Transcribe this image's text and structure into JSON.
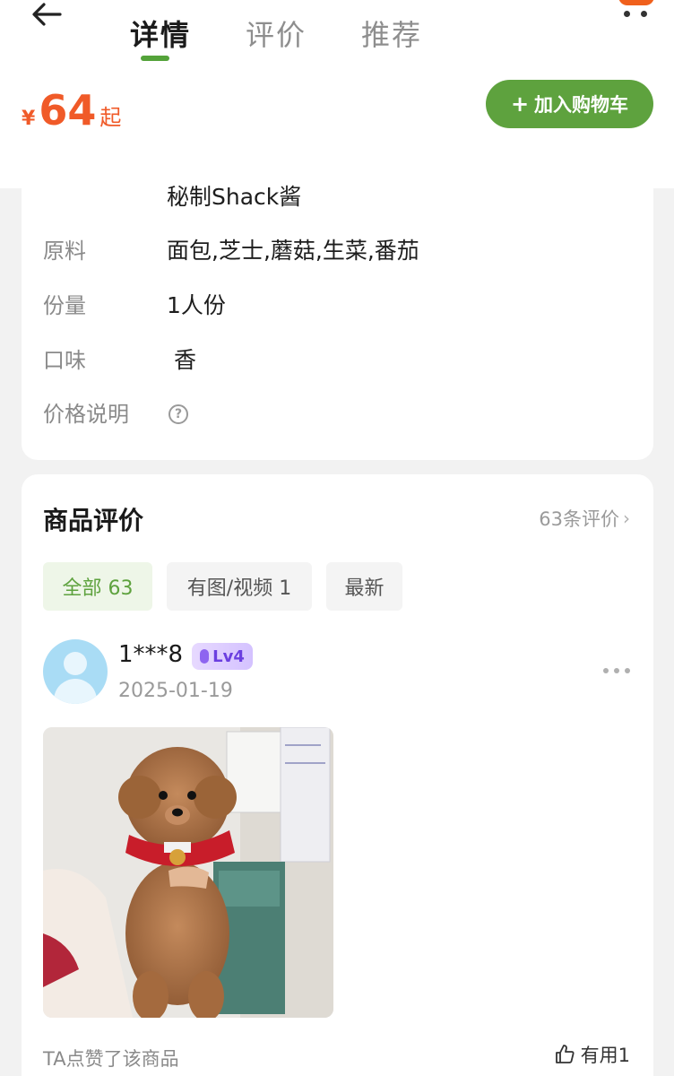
{
  "header": {
    "tabs": [
      {
        "label": "详情",
        "active": true
      },
      {
        "label": "评价",
        "active": false
      },
      {
        "label": "推荐",
        "active": false
      }
    ],
    "back_icon": "arrow-left-icon",
    "more_icon": "more-dots-icon",
    "accent_color": "#5ea23e"
  },
  "price": {
    "currency": "¥",
    "value": "64",
    "suffix": "起",
    "color": "#f05a28"
  },
  "cart_button": {
    "plus": "+",
    "label": "加入购物车"
  },
  "details": {
    "sauce": "秘制Shack酱",
    "rows": [
      {
        "label": "原料",
        "value": "面包,芝士,蘑菇,生菜,番茄"
      },
      {
        "label": "份量",
        "value": "1人份"
      },
      {
        "label": "口味",
        "value": "香"
      },
      {
        "label": "价格说明",
        "value": ""
      }
    ],
    "help_icon": "question-circle-icon",
    "help_glyph": "?"
  },
  "reviews": {
    "title": "商品评价",
    "count_text": "63条评价",
    "chevron": "›",
    "filters": [
      {
        "label": "全部 63",
        "active": true
      },
      {
        "label": "有图/视频 1",
        "active": false
      },
      {
        "label": "最新",
        "active": false
      }
    ],
    "items": [
      {
        "user": "1***8",
        "level": "Lv4",
        "date": "2025-01-19",
        "photo": "poodle-puppy-photo",
        "liked_text": "TA点赞了该商品",
        "useful_label": "有用1"
      }
    ]
  }
}
